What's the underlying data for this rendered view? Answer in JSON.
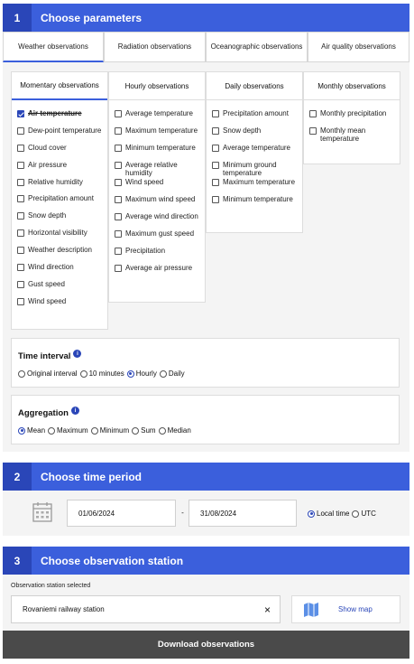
{
  "step1": {
    "num": "1",
    "title": "Choose parameters"
  },
  "top_tabs": [
    "Weather observations",
    "Radiation observations",
    "Oceanographic observations",
    "Air quality observations"
  ],
  "sub_tabs": [
    "Momentary observations",
    "Hourly observations",
    "Daily observations",
    "Monthly observations"
  ],
  "momentary": [
    {
      "label": "Air temperature",
      "checked": true
    },
    {
      "label": "Dew-point temperature"
    },
    {
      "label": "Cloud cover"
    },
    {
      "label": "Air pressure"
    },
    {
      "label": "Relative humidity"
    },
    {
      "label": "Precipitation amount"
    },
    {
      "label": "Snow depth"
    },
    {
      "label": "Horizontal visibility"
    },
    {
      "label": "Weather description"
    },
    {
      "label": "Wind direction"
    },
    {
      "label": "Gust speed"
    },
    {
      "label": "Wind speed"
    }
  ],
  "hourly": [
    {
      "label": "Average temperature"
    },
    {
      "label": "Maximum temperature"
    },
    {
      "label": "Minimum temperature"
    },
    {
      "label": "Average relative humidity"
    },
    {
      "label": "Wind speed"
    },
    {
      "label": "Maximum wind speed"
    },
    {
      "label": "Average wind direction"
    },
    {
      "label": "Maximum gust speed"
    },
    {
      "label": "Precipitation"
    },
    {
      "label": "Average air pressure"
    }
  ],
  "daily": [
    {
      "label": "Precipitation amount"
    },
    {
      "label": "Snow depth"
    },
    {
      "label": "Average temperature"
    },
    {
      "label": "Minimum ground temperature"
    },
    {
      "label": "Maximum temperature"
    },
    {
      "label": "Minimum temperature"
    }
  ],
  "monthly": [
    {
      "label": "Monthly precipitation"
    },
    {
      "label": "Monthly mean temperature"
    }
  ],
  "time_interval": {
    "title": "Time interval",
    "info": "i",
    "options": [
      "Original interval",
      "10 minutes",
      "Hourly",
      "Daily"
    ],
    "selected": "Hourly"
  },
  "aggregation": {
    "title": "Aggregation",
    "info": "i",
    "options": [
      "Mean",
      "Maximum",
      "Minimum",
      "Sum",
      "Median"
    ],
    "selected": "Mean"
  },
  "step2": {
    "num": "2",
    "title": "Choose time period"
  },
  "period": {
    "start": "01/06/2024",
    "separator": "-",
    "end": "31/08/2024",
    "tz_options": [
      "Local time",
      "UTC"
    ],
    "tz_selected": "Local time"
  },
  "step3": {
    "num": "3",
    "title": "Choose observation station"
  },
  "station": {
    "label": "Observation station selected",
    "value": "Rovaniemi railway station",
    "clear": "×",
    "show_map": "Show map"
  },
  "download_label": "Download observations",
  "colors": {
    "accent": "#3b5fdc",
    "accent_dark": "#2a46b8",
    "download_bg": "#4a4a4a"
  }
}
